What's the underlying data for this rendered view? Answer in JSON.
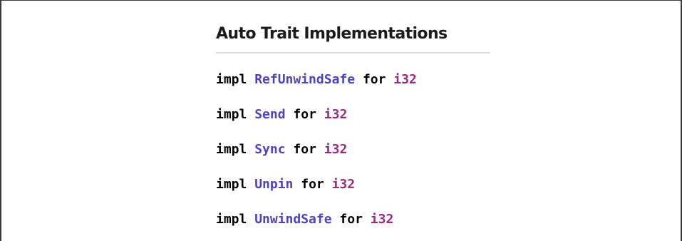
{
  "section": {
    "title": "Auto Trait Implementations"
  },
  "colors": {
    "trait_link": "#4d42c2",
    "primitive_link": "#9a2a7e",
    "keyword": "#000000",
    "divider": "#dddddd"
  },
  "impls": [
    {
      "impl_kw": "impl",
      "trait": "RefUnwindSafe",
      "for_kw": "for",
      "type": "i32"
    },
    {
      "impl_kw": "impl",
      "trait": "Send",
      "for_kw": "for",
      "type": "i32"
    },
    {
      "impl_kw": "impl",
      "trait": "Sync",
      "for_kw": "for",
      "type": "i32"
    },
    {
      "impl_kw": "impl",
      "trait": "Unpin",
      "for_kw": "for",
      "type": "i32"
    },
    {
      "impl_kw": "impl",
      "trait": "UnwindSafe",
      "for_kw": "for",
      "type": "i32"
    }
  ]
}
